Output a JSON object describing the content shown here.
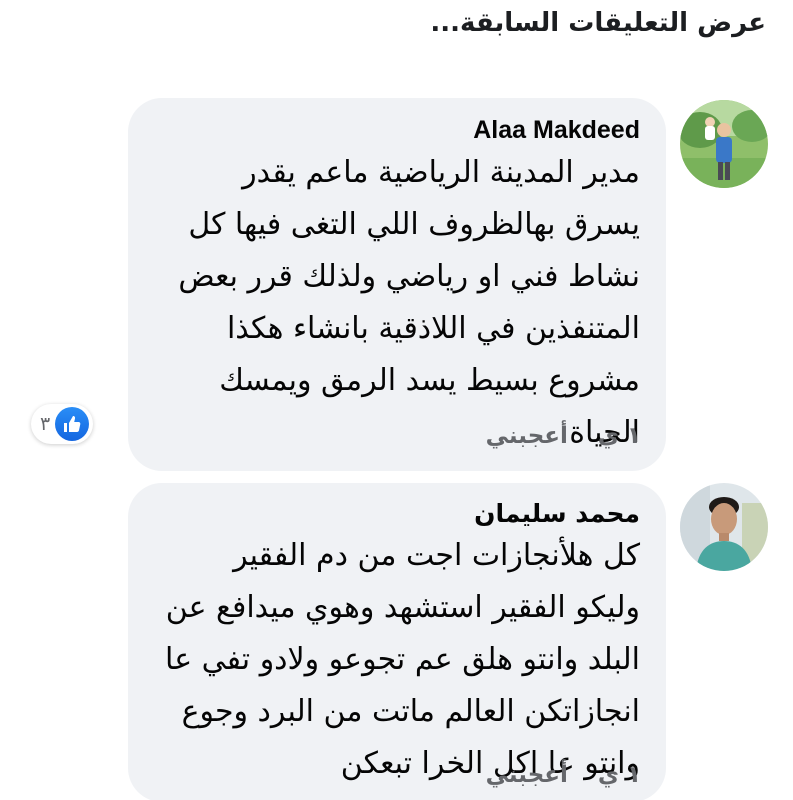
{
  "header": {
    "view_previous": "عرض التعليقات السابقة..."
  },
  "comments": [
    {
      "author": "Alaa Makdeed",
      "avatar_icon": "profile-photo",
      "text": "مدير المدينة الرياضية ماعم يقدر يسرق بهالظروف اللي التغى فيها كل نشاط فني او رياضي ولذلك قرر بعض المتنفذين في اللاذقية بانشاء هكذا مشروع بسيط يسد الرمق ويمسك الحياة",
      "time": "١ ي",
      "like_label": "أعجبني",
      "reactions": {
        "icon": "like-icon",
        "count": "٣"
      }
    },
    {
      "author": "محمد سليمان",
      "avatar_icon": "profile-photo",
      "text": "كل هلأنجازات اجت من دم الفقير وليكو الفقير استشهد وهوي ميدافع عن البلد وانتو هلق عم تجوعو ولادو تفي عا انجازاتكن العالم ماتت من البرد وجوع وانتو عا اكل الخرا تبعكن",
      "time": "١ ي",
      "like_label": "أعجبني"
    }
  ],
  "colors": {
    "bubble": "#f0f2f5",
    "meta_text": "#65676b",
    "like_blue": "#1877f2"
  }
}
